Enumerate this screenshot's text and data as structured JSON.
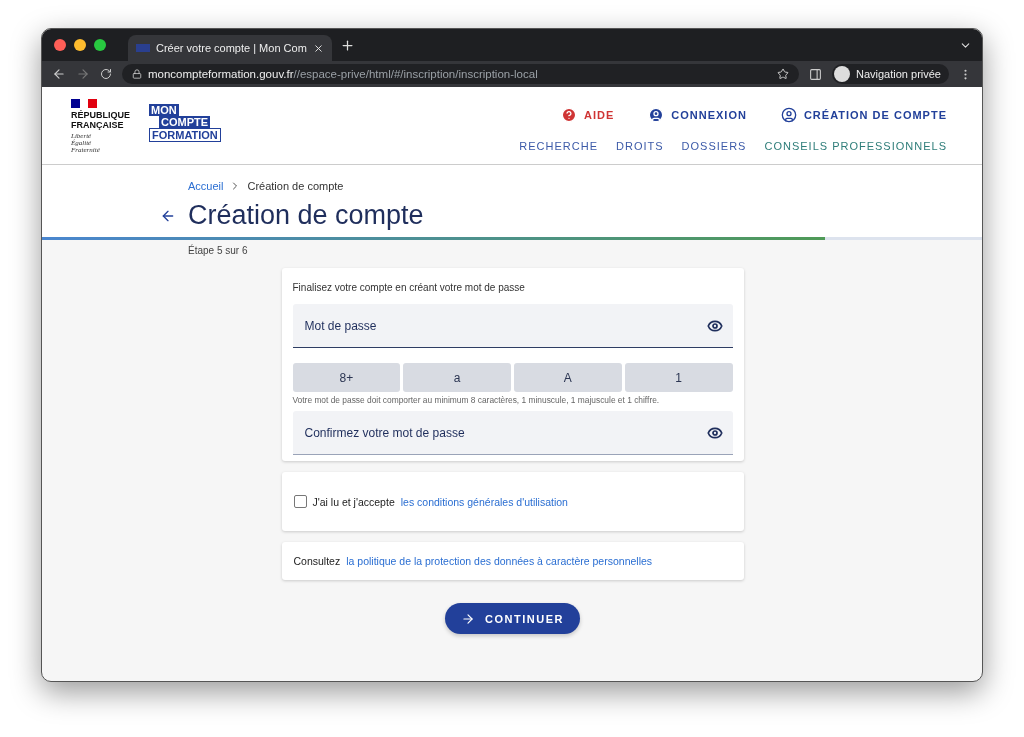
{
  "browser": {
    "tab_title": "Créer votre compte | Mon Com",
    "url_host": "moncompteformation.gouv.fr",
    "url_path": "//espace-prive/html/#/inscription/inscription-local",
    "profile": "Navigation privée"
  },
  "header": {
    "gov_logo": {
      "name": "RÉPUBLIQUE FRANÇAISE",
      "motto": [
        "Liberté",
        "Égalité",
        "Fraternité"
      ]
    },
    "brand": [
      "MON",
      "COMPTE",
      "FORMATION"
    ],
    "top_links": [
      {
        "label": "AIDE",
        "kind": "help"
      },
      {
        "label": "CONNEXION",
        "kind": "login"
      },
      {
        "label": "CRÉATION DE COMPTE",
        "kind": "account"
      }
    ],
    "nav": [
      {
        "label": "RECHERCHE"
      },
      {
        "label": "DROITS"
      },
      {
        "label": "DOSSIERS"
      },
      {
        "label": "CONSEILS PROFESSIONNELS"
      }
    ]
  },
  "breadcrumb": [
    "Accueil",
    "Création de compte"
  ],
  "title": "Création de compte",
  "progress": {
    "level": 0.833,
    "step": "Étape 5 sur 6"
  },
  "password_card": {
    "intro": "Finalisez votre compte en créant votre mot de passe",
    "password": {
      "placeholder": "Mot de passe"
    },
    "criteria": [
      "8+",
      "a",
      "A",
      "1"
    ],
    "hint": "Votre mot de passe doit comporter au minimum 8 caractères, 1 minuscule, 1 majuscule et 1 chiffre.",
    "confirm": {
      "placeholder": "Confirmez votre mot de passe"
    }
  },
  "terms": {
    "checked": false,
    "text": "J'ai lu et j'accepte",
    "link": "les conditions générales d'utilisation"
  },
  "privacy": {
    "text": "Consultez",
    "link": "la politique de la protection des données à caractère personnelles"
  },
  "continue_button": "CONTINUER"
}
